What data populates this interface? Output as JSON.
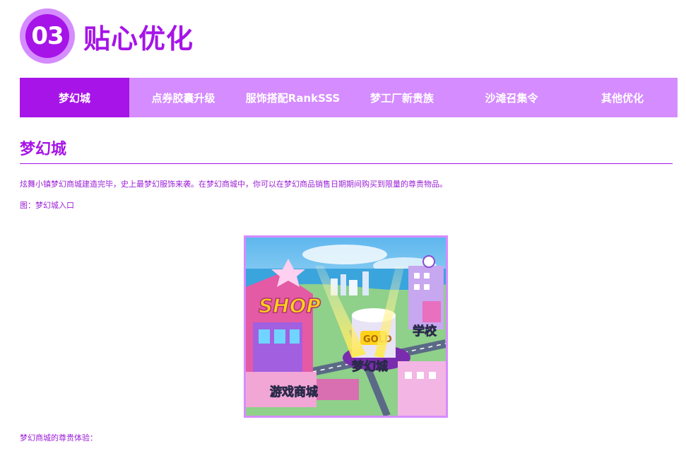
{
  "header": {
    "number": "03",
    "title": "贴心优化"
  },
  "tabs": [
    {
      "label": "梦幻城",
      "active": true
    },
    {
      "label": "点券胶囊升级",
      "active": false
    },
    {
      "label": "服饰搭配RankSSS",
      "active": false
    },
    {
      "label": "梦工厂新贵族",
      "active": false
    },
    {
      "label": "沙滩召集令",
      "active": false
    },
    {
      "label": "其他优化",
      "active": false
    }
  ],
  "content": {
    "title": "梦幻城",
    "paragraph1": "炫舞小镇梦幻商城建造完毕，史上最梦幻服饰来袭。在梦幻商城中，你可以在梦幻商品销售日期期间购买到限量的尊贵物品。",
    "caption": "图：梦幻城入口",
    "paragraph2": "梦幻商城的尊贵体验："
  },
  "image": {
    "shop_sign": "SHOP",
    "gold_sign": "GOLD",
    "label_school": "学校",
    "label_dream_city": "梦幻城",
    "label_game_mall": "游戏商城"
  },
  "colors": {
    "accent": "#a614e8",
    "tab_bg": "#d58cff",
    "text": "#9b1fd6"
  }
}
